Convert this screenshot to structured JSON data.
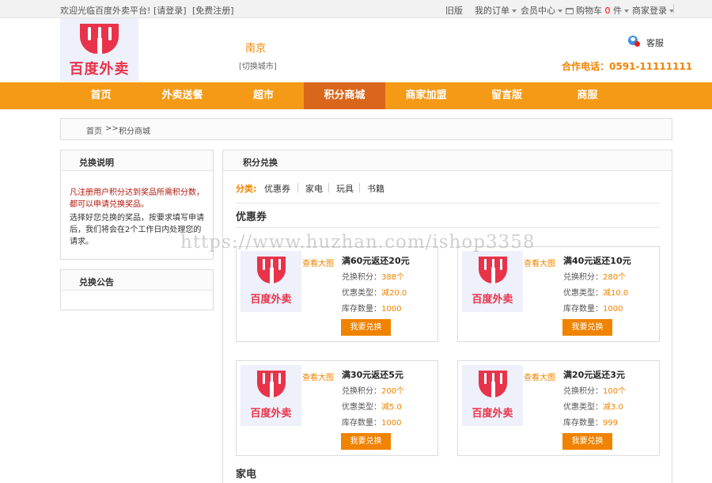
{
  "topbar": {
    "welcome": "欢迎光临百度外卖平台!",
    "login": "[请登录]",
    "register": "[免费注册]",
    "old_version": "旧版",
    "my_orders": "我的订单",
    "member_center": "会员中心",
    "cart_label": "购物车",
    "cart_count": "0",
    "cart_unit": "件",
    "merchant_login": "商家登录"
  },
  "header": {
    "logo_text": "百度外卖",
    "city": "南京",
    "switch_city": "[切换城市]",
    "service": "客服",
    "phone": "合作电话：0591-11111111"
  },
  "nav": {
    "items": [
      "首页",
      "外卖送餐",
      "超市",
      "积分商城",
      "商家加盟",
      "留言版",
      "商服"
    ],
    "active_index": 3
  },
  "breadcrumb": {
    "home": "首页",
    "separator": ">>",
    "current": "积分商城"
  },
  "sidebar": {
    "explain": {
      "title": "兑换说明",
      "note_red": "凡注册用户积分达到奖品所需积分数，都可以申请兑换奖品。",
      "note_black": "选择好您兑换的奖品，按要求填写申请后，我们将会在2个工作日内处理您的请求。"
    },
    "notice": {
      "title": "兑换公告"
    }
  },
  "main": {
    "title": "积分兑换",
    "category_label": "分类:",
    "categories": [
      "优惠券",
      "家电",
      "玩具",
      "书籍"
    ],
    "section1_title": "优惠券",
    "section2_title": "家电",
    "view_large": "查看大图",
    "field_points": "兑换积分：",
    "field_type": "优惠类型：",
    "field_stock": "库存数量：",
    "exchange_button": "我要兑换",
    "cards": [
      {
        "title": "满60元返还20元",
        "points": "388个",
        "type": "减20.0",
        "stock": "1000",
        "image_text": "百度外卖"
      },
      {
        "title": "满40元返还10元",
        "points": "280个",
        "type": "减10.0",
        "stock": "1000",
        "image_text": "百度外卖"
      },
      {
        "title": "满30元返还5元",
        "points": "200个",
        "type": "减5.0",
        "stock": "1000",
        "image_text": "百度外卖"
      },
      {
        "title": "满20元返还3元",
        "points": "100个",
        "type": "减3.0",
        "stock": "999",
        "image_text": "百度外卖"
      }
    ]
  },
  "watermark": "https://www.huzhan.com/ishop3358",
  "colors": {
    "accent": "#f08300",
    "nav_bg": "#f59a16",
    "nav_active": "#d9661b",
    "brand_red": "#e8334a"
  }
}
